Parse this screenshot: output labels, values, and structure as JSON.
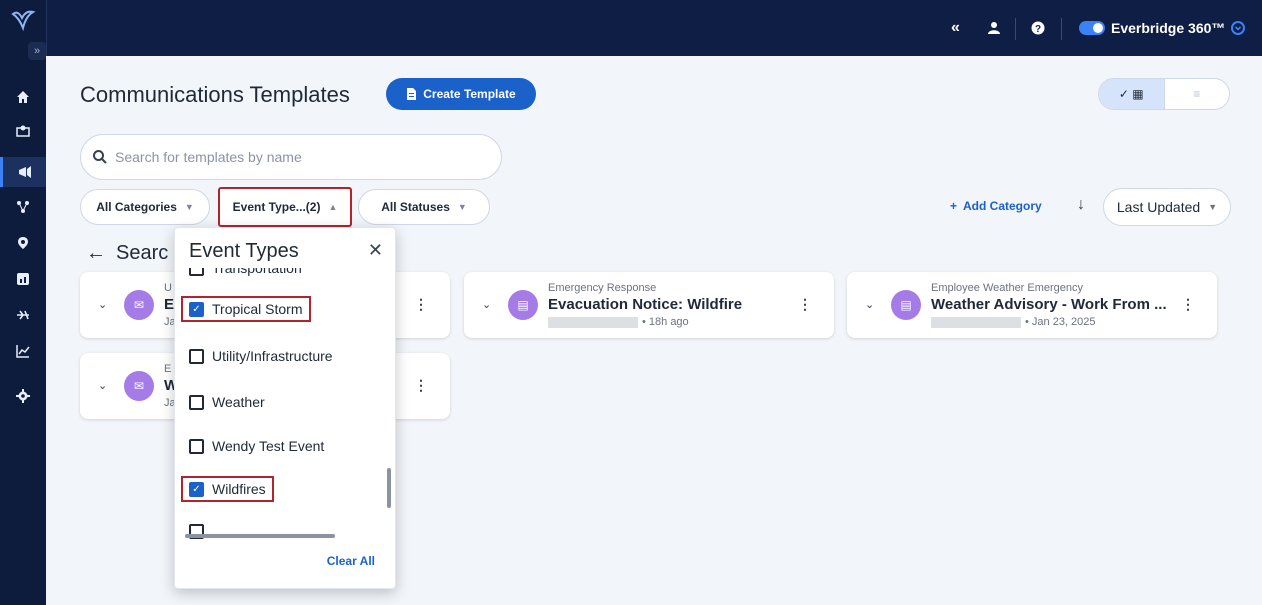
{
  "topbar": {
    "collapse_glyph": "«",
    "product_name": "Everbridge 360™"
  },
  "rail": {
    "expand_glyph": "»",
    "icons": [
      "home-icon",
      "map-icon",
      "megaphone-icon",
      "network-icon",
      "location-pin-icon",
      "report-icon",
      "route-icon",
      "chart-icon",
      "gear-icon"
    ]
  },
  "page": {
    "title": "Communications Templates",
    "create_button": "Create Template"
  },
  "view_toggle": {
    "grid_label": "✓ ▦",
    "list_label": "≡"
  },
  "search": {
    "placeholder": "Search for templates by name"
  },
  "filters": {
    "categories": "All Categories",
    "event_type": "Event Type...(2)",
    "statuses": "All Statuses"
  },
  "add_category": "Add Category",
  "sort": {
    "selected": "Last Updated"
  },
  "results_heading": "Searc",
  "cards": [
    {
      "category": "U",
      "name": "E",
      "meta": "Ja",
      "redacted": false
    },
    {
      "category": "Emergency Response",
      "name": "Evacuation Notice: Wildfire",
      "meta": "• 18h ago",
      "redacted": true
    },
    {
      "category": "Employee Weather Emergency",
      "name": "Weather Advisory - Work From ...",
      "meta": "• Jan 23, 2025",
      "redacted": true
    },
    {
      "category": "E",
      "name": "W",
      "meta": "Ja",
      "redacted": false
    }
  ],
  "dropdown": {
    "title": "Event Types",
    "items": [
      {
        "label": "Transportation",
        "checked": false
      },
      {
        "label": "Tropical Storm",
        "checked": true
      },
      {
        "label": "Utility/Infrastructure",
        "checked": false
      },
      {
        "label": "Weather",
        "checked": false
      },
      {
        "label": "Wendy Test Event",
        "checked": false
      },
      {
        "label": "Wildfires",
        "checked": true
      }
    ],
    "clear_all": "Clear All"
  },
  "colors": {
    "nav_bg": "#0d1b3d",
    "topbar_bg": "#0f1e44",
    "accent": "#1a62c9",
    "highlight_border": "#b3222f",
    "avatar": "#a57be8"
  }
}
